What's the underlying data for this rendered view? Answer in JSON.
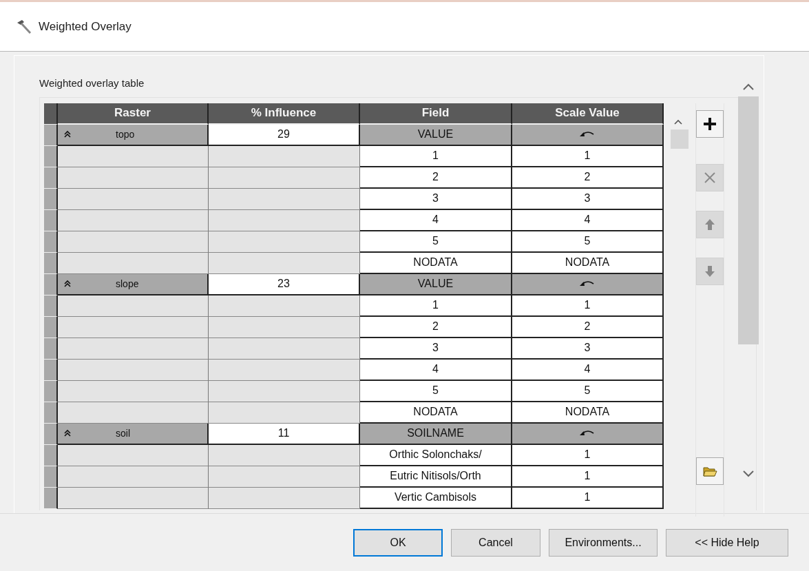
{
  "window": {
    "title": "Weighted Overlay"
  },
  "section_label": "Weighted overlay table",
  "table": {
    "columns": [
      "Raster",
      "% Influence",
      "Field",
      "Scale Value"
    ],
    "groups": [
      {
        "raster": "topo",
        "expanded": true,
        "influence": "29",
        "field": "VALUE",
        "rows": [
          {
            "field": "1",
            "scale_value": "1"
          },
          {
            "field": "2",
            "scale_value": "2"
          },
          {
            "field": "3",
            "scale_value": "3"
          },
          {
            "field": "4",
            "scale_value": "4"
          },
          {
            "field": "5",
            "scale_value": "5"
          },
          {
            "field": "NODATA",
            "scale_value": "NODATA"
          }
        ]
      },
      {
        "raster": "slope",
        "expanded": true,
        "influence": "23",
        "field": "VALUE",
        "rows": [
          {
            "field": "1",
            "scale_value": "1"
          },
          {
            "field": "2",
            "scale_value": "2"
          },
          {
            "field": "3",
            "scale_value": "3"
          },
          {
            "field": "4",
            "scale_value": "4"
          },
          {
            "field": "5",
            "scale_value": "5"
          },
          {
            "field": "NODATA",
            "scale_value": "NODATA"
          }
        ]
      },
      {
        "raster": "soil",
        "expanded": true,
        "influence": "11",
        "field": "SOILNAME",
        "rows": [
          {
            "field": "Orthic Solonchaks/",
            "scale_value": "1"
          },
          {
            "field": "Eutric Nitisols/Orth",
            "scale_value": "1"
          },
          {
            "field": "Vertic Cambisols",
            "scale_value": "1"
          }
        ]
      }
    ]
  },
  "tools": [
    {
      "kind": "add",
      "disabled": false
    },
    {
      "kind": "remove",
      "disabled": true
    },
    {
      "kind": "up",
      "disabled": true
    },
    {
      "kind": "down",
      "disabled": true
    },
    {
      "kind": "open",
      "disabled": false
    }
  ],
  "buttons": [
    {
      "label": "OK",
      "default": true
    },
    {
      "label": "Cancel",
      "default": false
    },
    {
      "label": "Environments...",
      "default": false
    },
    {
      "label": "<< Hide Help",
      "default": false
    }
  ]
}
